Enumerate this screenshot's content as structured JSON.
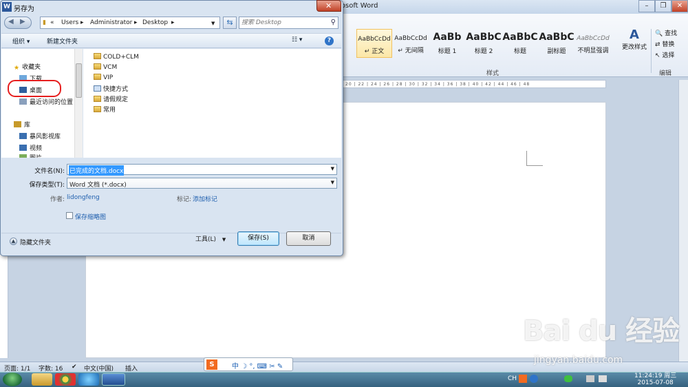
{
  "word": {
    "title_partial": "rosoft Word",
    "styles": [
      {
        "sample": "AaBbCcDd",
        "name": "↵ 正文"
      },
      {
        "sample": "AaBbCcDd",
        "name": "↵ 无间隔"
      },
      {
        "sample": "AaBb",
        "name": "标题 1"
      },
      {
        "sample": "AaBbC",
        "name": "标题 2"
      },
      {
        "sample": "AaBbC",
        "name": "标题"
      },
      {
        "sample": "AaBbC",
        "name": "副标题"
      },
      {
        "sample": "AaBbCcDd",
        "name": "不明显强调"
      }
    ],
    "change_styles": "更改样式",
    "group_styles": "样式",
    "group_edit": "编辑",
    "edit_find": "查找",
    "edit_replace": "替换",
    "edit_select": "选择",
    "ruler": "20 | 22 | 24 | 26 | 28 | 30 | 32 | 34 | 36 | 38 | 40 | 42 | 44 | 46 | 48",
    "status": {
      "page": "页面: 1/1",
      "words": "字数: 16",
      "lang": "中文(中国)",
      "mode": "插入"
    },
    "ime": "中 ☽ °, ⌨ ✂ ✎"
  },
  "taskbar": {
    "tray_lang": "CH",
    "time": "11:24:19 周三",
    "date": "2015-07-08"
  },
  "dialog": {
    "title": "另存为",
    "breadcrumb": [
      "«",
      "Users",
      "▸",
      "Administrator",
      "▸",
      "Desktop",
      "▸"
    ],
    "search_placeholder": "搜索 Desktop",
    "toolbar": {
      "organize": "组织 ▾",
      "new_folder": "新建文件夹",
      "view": "☷ ▾"
    },
    "tree": [
      {
        "label": "收藏夹",
        "icon": "star"
      },
      {
        "label": "下载",
        "icon": "download"
      },
      {
        "label": "桌面",
        "icon": "desktop"
      },
      {
        "label": "最近访问的位置",
        "icon": "recent"
      },
      {
        "label": "库",
        "icon": "library"
      },
      {
        "label": "暴风影视库",
        "icon": "video"
      },
      {
        "label": "视频",
        "icon": "video"
      },
      {
        "label": "图片",
        "icon": "picture"
      }
    ],
    "files": [
      {
        "name": "COLD+CLM",
        "kind": "folder"
      },
      {
        "name": "VCM",
        "kind": "folder"
      },
      {
        "name": "VIP",
        "kind": "folder"
      },
      {
        "name": "快捷方式",
        "kind": "shortcut"
      },
      {
        "name": "请假规定",
        "kind": "folder"
      },
      {
        "name": "常用",
        "kind": "folder"
      }
    ],
    "filename_label": "文件名(N):",
    "filename_value": "已完成的文档.docx",
    "filetype_label": "保存类型(T):",
    "filetype_value": "Word 文档 (*.docx)",
    "author_label": "作者:",
    "author_value": "lidongfeng",
    "tags_label": "标记:",
    "tags_value": "添加标记",
    "thumbnail_label": "保存缩略图",
    "hide_folders": "隐藏文件夹",
    "tools": "工具(L)",
    "save": "保存(S)",
    "cancel": "取消"
  },
  "watermark": {
    "logo": "Bai du 经验",
    "url": "jingyan.baidu.com"
  },
  "colors": {
    "accent": "#3399ff",
    "highlight": "#e61e1e",
    "ribbon": "#e4ebf5"
  }
}
